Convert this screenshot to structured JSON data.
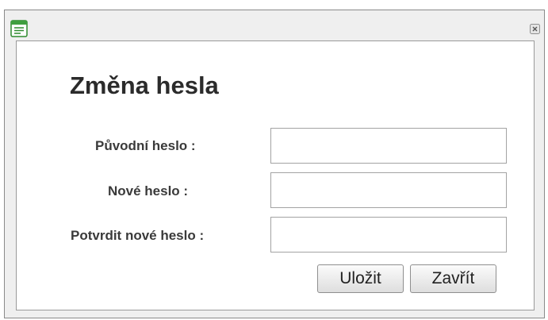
{
  "dialog": {
    "title": "Změna hesla",
    "app_icon": "form-document-icon",
    "close_icon": "close-x-icon",
    "accent_color": "#2e8b2e"
  },
  "form": {
    "old_password_label": "Původní heslo :",
    "old_password_value": "",
    "new_password_label": "Nové heslo :",
    "new_password_value": "",
    "confirm_password_label": "Potvrdit nové heslo :",
    "confirm_password_value": ""
  },
  "buttons": {
    "save_label": "Uložit",
    "close_label": "Zavřít"
  }
}
